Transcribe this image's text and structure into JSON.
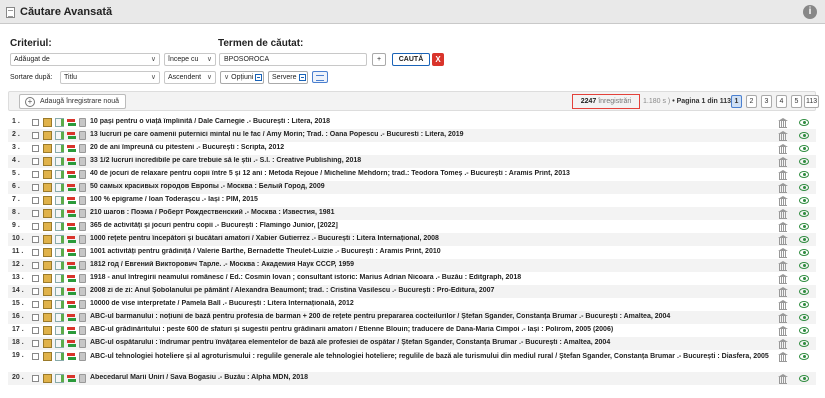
{
  "window": {
    "title": "Căutare Avansată"
  },
  "search": {
    "criteriu_label": "Criteriul:",
    "termen_label": "Termen de căutat:",
    "criteriu_value": "Adăugat de",
    "match_value": "începe cu",
    "term_value": "BPOSOROCA",
    "plus_label": "+",
    "search_label": "CAUTĂ",
    "clear_label": "X"
  },
  "sort": {
    "label": "Sortare după:",
    "field_value": "Titlu",
    "order_value": "Ascendent",
    "options_label": "Opțiuni",
    "servers_label": "Servere"
  },
  "toolbar": {
    "add_label": "Adaugă înregistrare nouă",
    "count": "2247",
    "count_label": "înregistrări",
    "time_text": "1.180 s )",
    "page_text": "• Pagina 1 din 113",
    "pages": [
      "1",
      "2",
      "3",
      "4",
      "5"
    ],
    "last_page": "113"
  },
  "results": [
    {
      "num": "1 .",
      "text": "10 pași pentru o viață împlinită / Dale Carnegie .- București : Litera, 2018"
    },
    {
      "num": "2 .",
      "text": "13 lucruri pe care oamenii puternici mintal nu le fac / Amy Morin; Trad. : Oana Popescu .- Bucuresti : Litera, 2019"
    },
    {
      "num": "3 .",
      "text": "20 de ani împreună cu pitesteni .- București : Scripta, 2012"
    },
    {
      "num": "4 .",
      "text": "33 1/2 lucruri incredibile pe care trebuie să le știi .- S.l. : Creative Publishing, 2018"
    },
    {
      "num": "5 .",
      "text": "40 de jocuri de relaxare pentru copii între 5 și 12 ani : Metoda Rejoue / Micheline Mehdorn; trad.: Teodora Tomeș .- București : Aramis Print, 2013"
    },
    {
      "num": "6 .",
      "text": "50 самых красивых городов Европы .- Москва : Белый Город, 2009"
    },
    {
      "num": "7 .",
      "text": "100 % epigrame / Ioan Toderașcu .- Iași : PIM, 2015"
    },
    {
      "num": "8 .",
      "text": "210 шагов : Поэма / Роберт Рождественский .- Москва : Известия, 1981"
    },
    {
      "num": "9 .",
      "text": "365 de activități și jocuri pentru copii .- București : Flamingo Junior, [2022]"
    },
    {
      "num": "10 .",
      "text": "1000 rețete pentru începători și bucătari amatori / Xabier Gutierrez .- București : Litera Internațional, 2008"
    },
    {
      "num": "11 .",
      "text": "1001 activități pentru grădiniță / Valerie Barthe, Bernadette Theulet-Luizie .- București : Aramis Print, 2010"
    },
    {
      "num": "12 .",
      "text": "1812 год / Евгений Викторович Тарле. .- Москва : Академия Наук СССР, 1959"
    },
    {
      "num": "13 .",
      "text": "1918 - anul întregirii neamului românesc / Ed.: Cosmin Iovan ; consultant istoric: Marius Adrian Nicoara .- Buzău : Editgraph, 2018"
    },
    {
      "num": "14 .",
      "text": "2008 zi de zi: Anul Șobolanului pe pământ / Alexandra Beaumont; trad. : Cristina Vasilescu .- București : Pro-Editura, 2007"
    },
    {
      "num": "15 .",
      "text": "10000 de vise interpretate / Pamela Ball .- București : Litera Internațională, 2012"
    },
    {
      "num": "16 .",
      "text": "ABC-ul barmanului : noțiuni de bază pentru profesia de barman + 200 de rețete pentru prepararea cocteilurilor / Ștefan Sgander, Constanța Brumar .- București : Amaltea, 2004"
    },
    {
      "num": "17 .",
      "text": "ABC-ul grădinăritului : peste 600 de sfaturi și sugestii pentru grădinarii amatori / Etienne Blouin; traducere de Dana-Maria Cimpoi .- Iași : Polirom, 2005 (2006)"
    },
    {
      "num": "18 .",
      "text": "ABC-ul ospătarului : îndrumar pentru învățarea elementelor de bază ale profesiei de ospătar / Ștefan Sgander, Constanța Brumar .- București : Amaltea, 2004"
    },
    {
      "num": "19 .",
      "text": "ABC-ul tehnologiei hoteliere și al agroturismului : regulile generale ale tehnologiei hoteliere; regulile de bază ale turismului din mediul rural / Ștefan Sgander, Constanța Brumar .- București : Diasfera, 2005"
    },
    {
      "num": "20 .",
      "text": "Abecedarul Marii Uniri / Sava Bogasiu .- Buzău : Alpha MDN, 2018"
    }
  ]
}
